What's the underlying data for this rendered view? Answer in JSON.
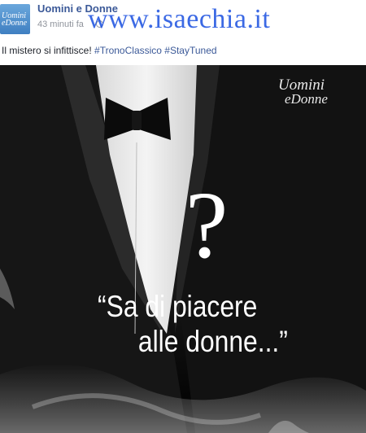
{
  "post": {
    "page_name": "Uomini e Donne",
    "timestamp": "43 minuti fa",
    "caption_text": "Il mistero si infittisce! ",
    "hashtags": [
      "#TronoClassico",
      "#StayTuned"
    ],
    "avatar_text": [
      "Uomini",
      "eDonne"
    ]
  },
  "watermark": "www.isaechia.it",
  "image": {
    "show_logo": [
      "Uomini",
      "eDonne"
    ],
    "question_mark": "?",
    "quote_lines": [
      "“Sa di piacere",
      "alle donne...”"
    ]
  },
  "colors": {
    "link": "#3b5998",
    "watermark": "#1a4fe0",
    "photo_background": "#0a0a0a"
  },
  "icons": [
    "globe-icon"
  ]
}
